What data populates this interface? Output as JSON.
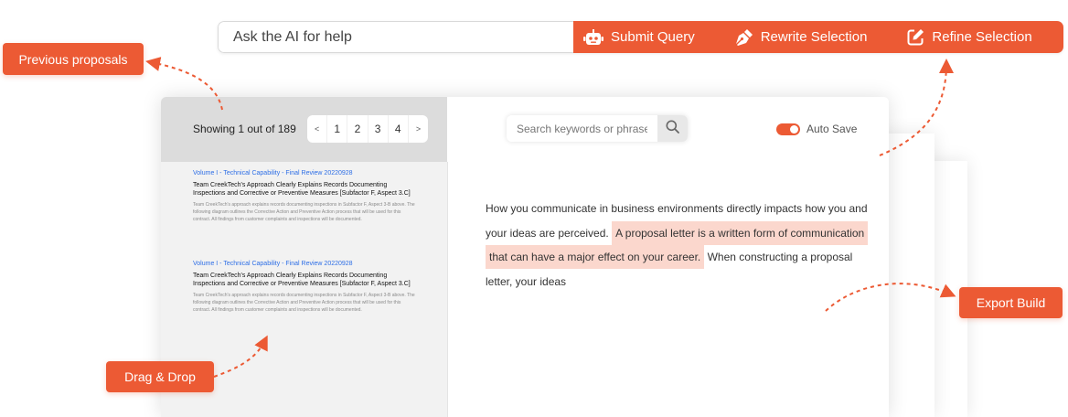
{
  "ai_bar": {
    "placeholder": "Ask the AI for help",
    "submit_label": "Submit Query",
    "rewrite_label": "Rewrite Selection",
    "refine_label": "Refine Selection"
  },
  "sidebar": {
    "showing_text": "Showing 1 out of 189",
    "pager": {
      "prev": "<",
      "pages": [
        "1",
        "2",
        "3",
        "4"
      ],
      "next": ">"
    },
    "proposals": [
      {
        "title": "Volume I - Technical Capability - Final Review 20220928",
        "heading": "Team CreekTech's Approach Clearly Explains Records Documenting Inspections and Corrective or Preventive Measures [Subfactor F, Aspect 3.C]",
        "body": "Team CreekTech's approach explains records documenting inspections in Subfactor F, Aspect 3-B above. The following diagram outlines the Corrective Action and Preventive Action process that will be used for this contract. All findings from customer complaints and inspections will be documented."
      },
      {
        "title": "Volume I - Technical Capability - Final Review 20220928",
        "heading": "Team CreekTech's Approach Clearly Explains Records Documenting Inspections and Corrective or Preventive Measures [Subfactor F, Aspect 3.C]",
        "body": "Team CreekTech's approach explains records documenting inspections in Subfactor F, Aspect 3-B above. The following diagram outlines the Corrective Action and Preventive Action process that will be used for this contract. All findings from customer complaints and inspections will be documented."
      }
    ]
  },
  "editor": {
    "search_placeholder": "Search keywords or phrase",
    "autosave_label": "Auto Save",
    "autosave_on": true,
    "text_before": "How you   communicate   in business environments directly impacts how you and your ideas are perceived.",
    "text_highlight": "A  proposal letter is a written form of communication that can have a major effect on your career.",
    "text_after": " When constructing a proposal letter, your ideas"
  },
  "callouts": {
    "previous": "Previous proposals",
    "drag": "Drag & Drop",
    "export": "Export Build"
  },
  "colors": {
    "accent": "#ec5a34",
    "highlight": "#fbd7cd",
    "link": "#2d6ee6"
  }
}
